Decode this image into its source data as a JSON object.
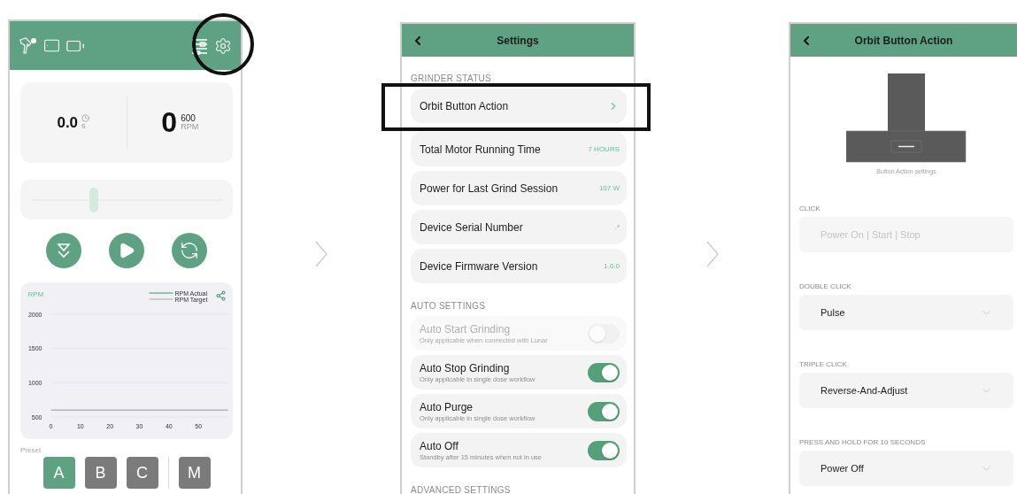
{
  "home": {
    "settings_highlighted": true,
    "readings": {
      "time": "0.0",
      "time_unit": "s",
      "speed": "0",
      "speed_target": "600",
      "speed_unit": "RPM"
    },
    "slider": {
      "level": 0.33
    },
    "chart": {
      "chart_data": {
        "type": "line",
        "title": "RPM",
        "x": [
          0,
          10,
          20,
          30,
          40,
          50,
          60
        ],
        "series": [
          {
            "name": "RPM Actual",
            "color": "#5aa582",
            "values": [
              null,
              null,
              null,
              null,
              null,
              null,
              null
            ]
          },
          {
            "name": "RPM Target",
            "color": "#b4b4b4",
            "values": [
              600,
              600,
              600,
              600,
              600,
              600,
              600
            ]
          }
        ],
        "xlim": [
          0,
          60
        ],
        "ylim": [
          500,
          2000
        ],
        "xticks": [
          0,
          10,
          20,
          30,
          40,
          50
        ],
        "yticks": [
          500,
          1000,
          1500,
          2000
        ]
      }
    },
    "preset": {
      "label": "Preset",
      "buttons": [
        {
          "label": "A",
          "kind": "preset",
          "selected": true
        },
        {
          "label": "B",
          "kind": "preset",
          "selected": false
        },
        {
          "label": "C",
          "kind": "preset",
          "selected": false
        },
        {
          "label": "M",
          "kind": "manual",
          "selected": false
        }
      ]
    }
  },
  "settings": {
    "title": "Settings",
    "sections": [
      {
        "title": "GRINDER STATUS",
        "rows": [
          {
            "kind": "link",
            "label": "Orbit Button Action",
            "highlighted": true
          },
          {
            "kind": "value",
            "label": "Total Motor Running Time",
            "value": "7 HOURS"
          },
          {
            "kind": "value",
            "label": "Power for Last Grind Session",
            "value": "107 W"
          },
          {
            "kind": "value",
            "label": "Device Serial Number",
            "value": ".*"
          },
          {
            "kind": "value",
            "label": "Device Firmware Version",
            "value": "1.0.0"
          }
        ]
      },
      {
        "title": "AUTO SETTINGS",
        "rows": [
          {
            "kind": "toggle",
            "label": "Auto Start Grinding",
            "sublabel": "Only applicable when connected with Lunar",
            "on": false,
            "disabled": true
          },
          {
            "kind": "toggle",
            "label": "Auto Stop Grinding",
            "sublabel": "Only applicable in single dose workflow",
            "on": true,
            "disabled": false
          },
          {
            "kind": "toggle",
            "label": "Auto Purge",
            "sublabel": "Only applicable in single dose workflow",
            "on": true,
            "disabled": false
          },
          {
            "kind": "toggle",
            "label": "Auto Off",
            "sublabel": "Standby after 15 minutes when not in use",
            "on": true,
            "disabled": false
          }
        ]
      },
      {
        "title": "ADVANCED SETTINGS"
      }
    ]
  },
  "button_action": {
    "title": "Orbit Button Action",
    "caption": "Button Action settings",
    "fields": [
      {
        "label": "CLICK",
        "value": "Power On | Start | Stop",
        "disabled": true
      },
      {
        "label": "DOUBLE CLICK",
        "value": "Pulse",
        "disabled": false
      },
      {
        "label": "TRIPLE CLICK",
        "value": "Reverse-And-Adjust",
        "disabled": false
      },
      {
        "label": "PRESS AND HOLD FOR 10 SECONDS",
        "value": "Power Off",
        "disabled": false
      }
    ]
  }
}
